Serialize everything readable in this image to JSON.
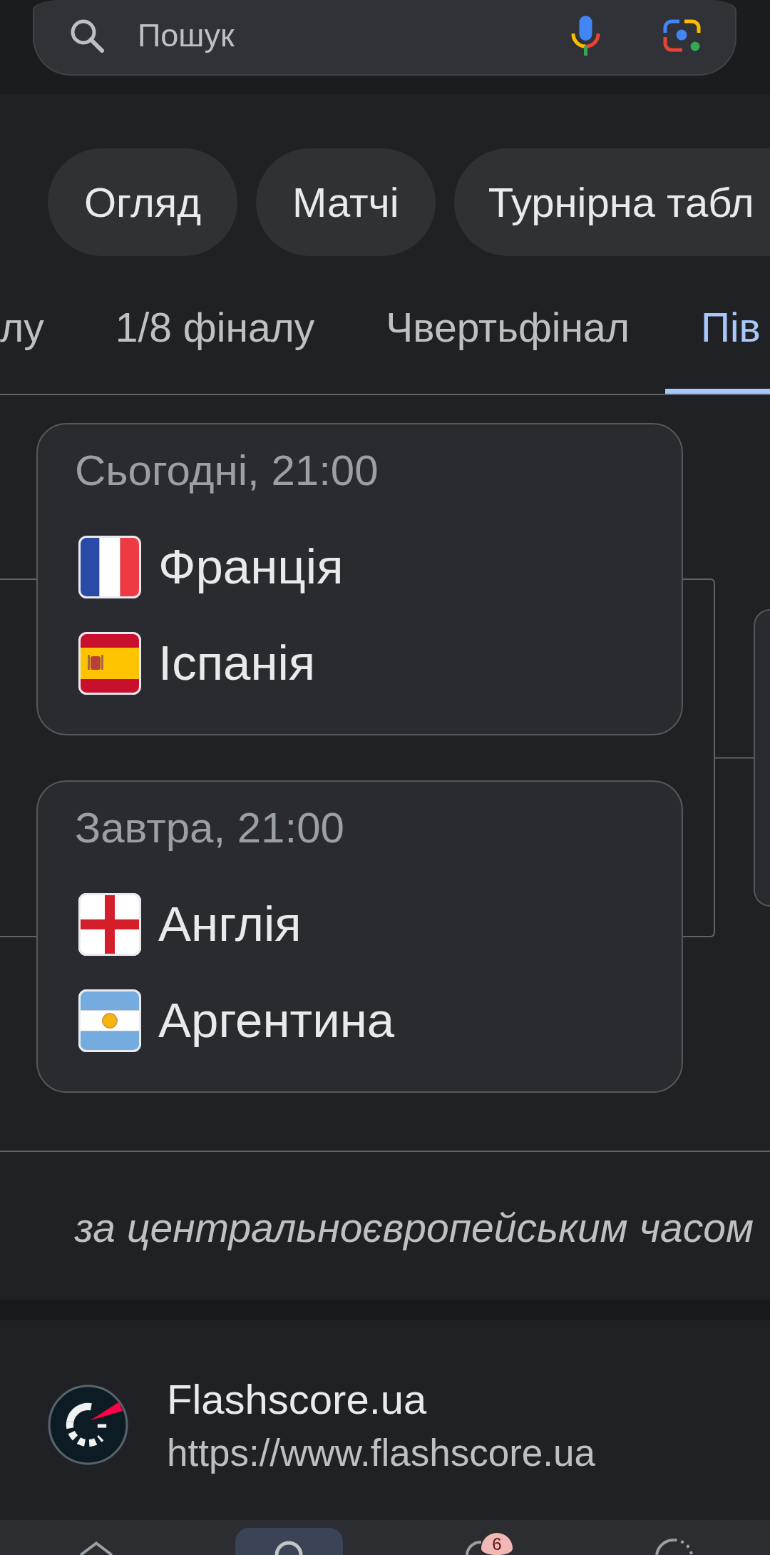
{
  "search": {
    "placeholder": "Пошук"
  },
  "chips": [
    "Огляд",
    "Матчі",
    "Турнірна табл"
  ],
  "round_tabs": [
    {
      "label": "лу",
      "selected": false
    },
    {
      "label": "1/8 фіналу",
      "selected": false
    },
    {
      "label": "Чвертьфінал",
      "selected": false
    },
    {
      "label": "Пів",
      "selected": true
    }
  ],
  "matches": [
    {
      "time": "Сьогодні, 21:00",
      "teams": [
        {
          "name": "Франція"
        },
        {
          "name": "Іспанія"
        }
      ]
    },
    {
      "time": "Завтра, 21:00",
      "teams": [
        {
          "name": "Англія"
        },
        {
          "name": "Аргентина"
        }
      ]
    }
  ],
  "timezone_note": "за центральноєвропейським часом",
  "result": {
    "title": "Flashscore.ua",
    "url": "https://www.flashscore.ua"
  },
  "bottom_nav": {
    "items": [
      {
        "selected": false
      },
      {
        "selected": true
      },
      {
        "selected": false,
        "badge": "6"
      },
      {
        "selected": false
      }
    ]
  }
}
